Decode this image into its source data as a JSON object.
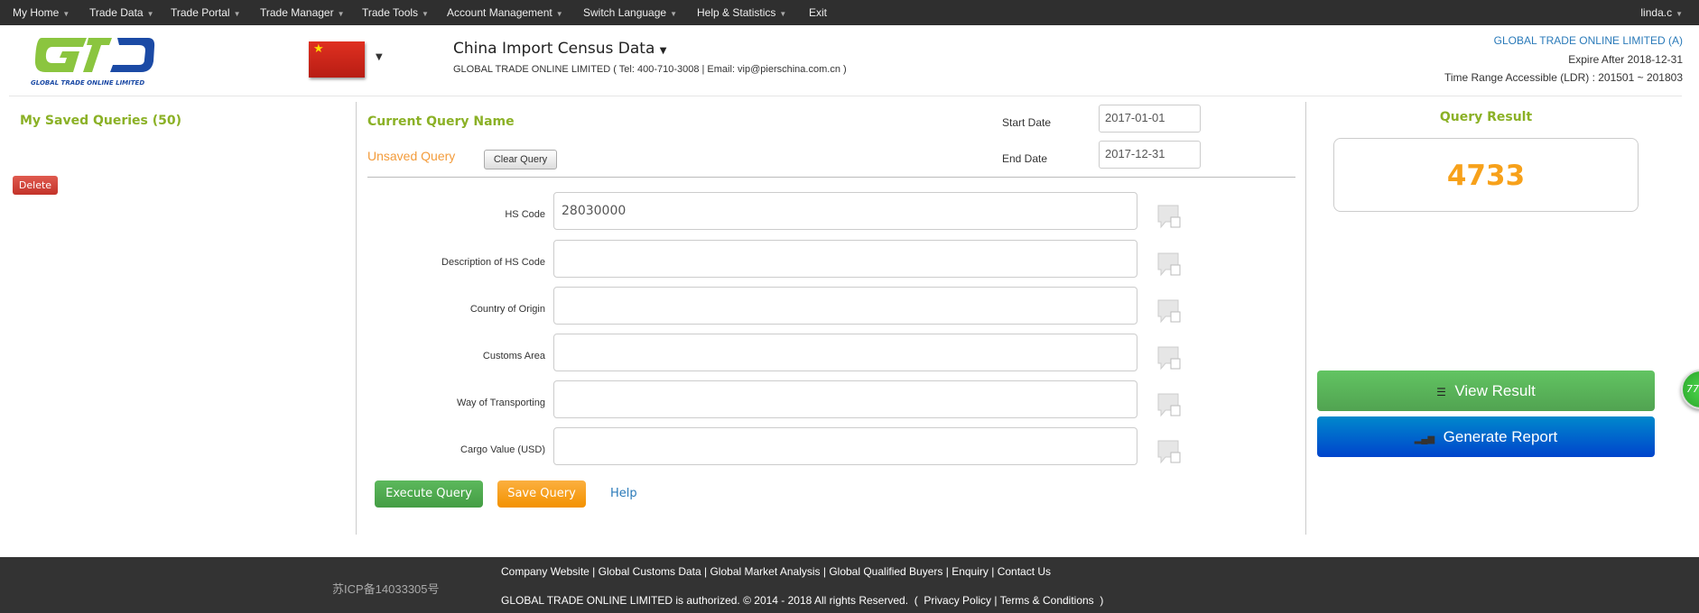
{
  "nav": {
    "items": [
      "My Home",
      "Trade Data",
      "Trade Portal",
      "Trade Manager",
      "Trade Tools",
      "Account Management",
      "Switch Language",
      "Help & Statistics",
      "Exit"
    ],
    "user": "linda.c"
  },
  "header": {
    "logo_text": "GLOBAL TRADE ONLINE LIMITED",
    "title": "China Import Census Data",
    "contact": "GLOBAL TRADE ONLINE LIMITED ( Tel: 400-710-3008 | Email: vip@pierschina.com.cn )",
    "account": "GLOBAL TRADE ONLINE LIMITED (A)",
    "expire": "Expire After 2018-12-31",
    "range": "Time Range Accessible (LDR) : 201501 ~ 201803"
  },
  "left": {
    "title": "My Saved Queries (50)",
    "delete": "Delete"
  },
  "query": {
    "name_label": "Current Query Name",
    "name": "Unsaved Query",
    "clear": "Clear Query",
    "start_label": "Start Date",
    "start": "2017-01-01",
    "end_label": "End Date",
    "end": "2017-12-31",
    "fields": [
      {
        "label": "HS Code",
        "value": "28030000"
      },
      {
        "label": "Description of HS Code",
        "value": ""
      },
      {
        "label": "Country of Origin",
        "value": ""
      },
      {
        "label": "Customs Area",
        "value": ""
      },
      {
        "label": "Way of Transporting",
        "value": ""
      },
      {
        "label": "Cargo Value (USD)",
        "value": ""
      }
    ],
    "execute": "Execute Query",
    "save": "Save Query",
    "help": "Help"
  },
  "result": {
    "title": "Query Result",
    "count": "4733",
    "view": "View Result",
    "report": "Generate Report",
    "badge": "77"
  },
  "footer": {
    "icp": "苏ICP备14033305号",
    "links": [
      "Company Website",
      "Global Customs Data",
      "Global Market Analysis",
      "Global Qualified Buyers",
      "Enquiry",
      "Contact Us"
    ],
    "copyright": "GLOBAL TRADE ONLINE LIMITED is authorized. © 2014 - 2018 All rights Reserved.",
    "privacy": "Privacy Policy",
    "terms": "Terms & Conditions"
  },
  "colors": {
    "green": "#8bb126",
    "orange": "#f7a11a",
    "blue": "#2a7ab9"
  }
}
